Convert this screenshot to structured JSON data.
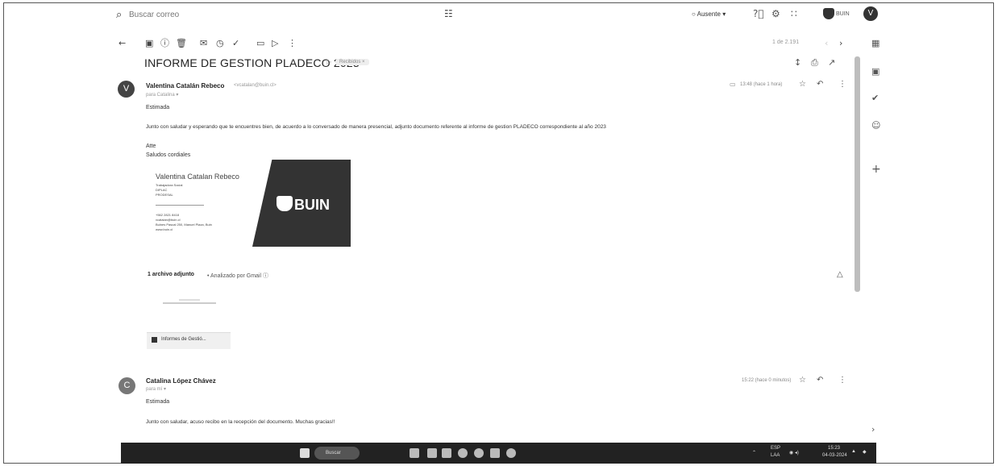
{
  "topbar": {
    "search_placeholder": "Buscar correo",
    "status": "Ausente",
    "brand": "BUIN",
    "avatar_letter": "V"
  },
  "toolbar": {
    "pager": "1 de 2.191"
  },
  "email": {
    "subject": "INFORME DE GESTION PLADECO 2023",
    "label": "Recibidos"
  },
  "messages": [
    {
      "avatar_letter": "V",
      "sender": "Valentina Catalán Rebeco",
      "sender_email": "<vcatalan@buin.cl>",
      "to": "para Catalina",
      "time": "13:48 (hace 1 hora)",
      "greeting": "Estimada",
      "body": "Junto con saludar y esperando que te encuentres bien, de acuerdo a lo conversado de manera presencial, adjunto documento referente al informe de gestion PLADECO correspondiente al año 2023",
      "closing1": "Atte",
      "closing2": "Saludos cordiales"
    },
    {
      "avatar_letter": "C",
      "sender": "Catalina López Chávez",
      "to": "para mí",
      "time": "15:22 (hace 0 minutos)",
      "greeting": "Estimada",
      "body": "Junto con saludar, acuso recibo en la recepción del documento. Muchas gracias!!"
    }
  ],
  "signature": {
    "name": "Valentina Catalan Rebeco",
    "role": "Trabajadora Social",
    "dept1": "DIPLAC",
    "dept2": "PRODESAL",
    "phone": "+562 2821 8418",
    "email": "vcatalan@buin.cl",
    "address": "Bulnes Pascal 250, Manuel Plaza, Buin",
    "web": "www.buin.cl",
    "logo": "BUIN"
  },
  "attachments": {
    "title": "1 archivo adjunto",
    "scanned": "• Analizado por Gmail",
    "file_name": "Informes de Gestió..."
  },
  "taskbar": {
    "search": "Buscar",
    "lang1": "ESP",
    "lang2": "LAA",
    "time": "15:23",
    "date": "04-03-2024"
  }
}
